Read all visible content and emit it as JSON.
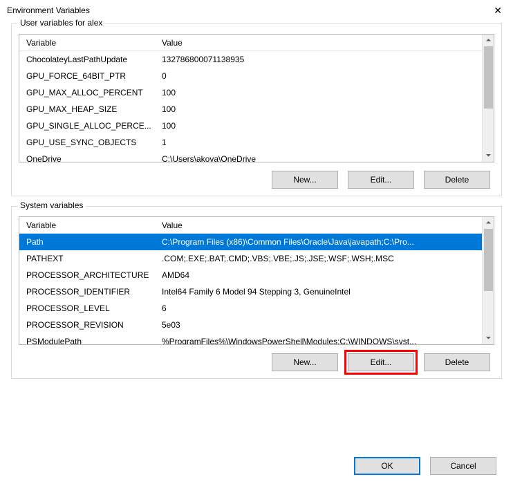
{
  "window": {
    "title": "Environment Variables"
  },
  "user_group": {
    "legend": "User variables for alex",
    "header_var": "Variable",
    "header_val": "Value",
    "rows": [
      {
        "var": "ChocolateyLastPathUpdate",
        "val": "132786800071138935"
      },
      {
        "var": "GPU_FORCE_64BIT_PTR",
        "val": "0"
      },
      {
        "var": "GPU_MAX_ALLOC_PERCENT",
        "val": "100"
      },
      {
        "var": "GPU_MAX_HEAP_SIZE",
        "val": "100"
      },
      {
        "var": "GPU_SINGLE_ALLOC_PERCE...",
        "val": "100"
      },
      {
        "var": "GPU_USE_SYNC_OBJECTS",
        "val": "1"
      },
      {
        "var": "OneDrive",
        "val": "C:\\Users\\akova\\OneDrive"
      }
    ],
    "buttons": {
      "new": "New...",
      "edit": "Edit...",
      "delete": "Delete"
    }
  },
  "system_group": {
    "legend": "System variables",
    "header_var": "Variable",
    "header_val": "Value",
    "rows": [
      {
        "var": "Path",
        "val": "C:\\Program Files (x86)\\Common Files\\Oracle\\Java\\javapath;C:\\Pro...",
        "selected": true
      },
      {
        "var": "PATHEXT",
        "val": ".COM;.EXE;.BAT;.CMD;.VBS;.VBE;.JS;.JSE;.WSF;.WSH;.MSC"
      },
      {
        "var": "PROCESSOR_ARCHITECTURE",
        "val": "AMD64"
      },
      {
        "var": "PROCESSOR_IDENTIFIER",
        "val": "Intel64 Family 6 Model 94 Stepping 3, GenuineIntel"
      },
      {
        "var": "PROCESSOR_LEVEL",
        "val": "6"
      },
      {
        "var": "PROCESSOR_REVISION",
        "val": "5e03"
      },
      {
        "var": "PSModulePath",
        "val": "%ProgramFiles%\\WindowsPowerShell\\Modules;C:\\WINDOWS\\syst..."
      }
    ],
    "buttons": {
      "new": "New...",
      "edit": "Edit...",
      "delete": "Delete"
    }
  },
  "footer": {
    "ok": "OK",
    "cancel": "Cancel"
  }
}
